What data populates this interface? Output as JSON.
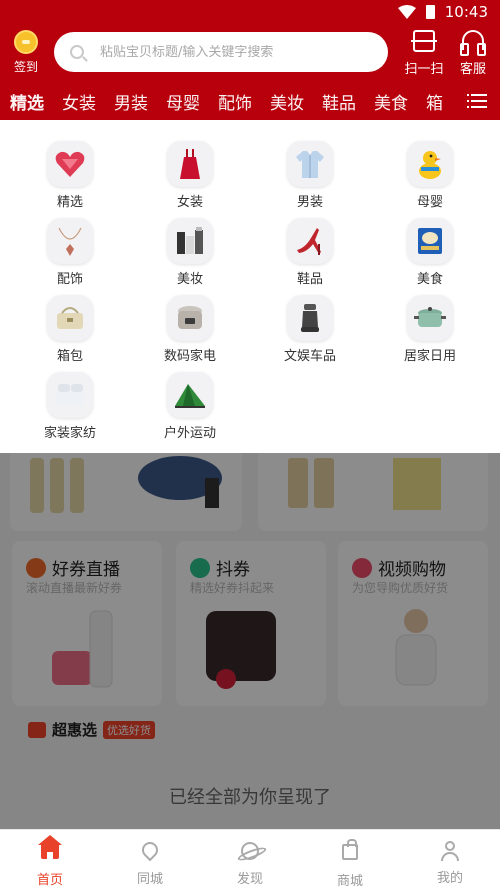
{
  "status_bar": {
    "time": "10:43"
  },
  "header": {
    "signin_label": "签到",
    "search_placeholder": "粘贴宝贝标题/输入关键字搜索",
    "scan_label": "扫一扫",
    "service_label": "客服"
  },
  "tabs": [
    "精选",
    "女装",
    "男装",
    "母婴",
    "配饰",
    "美妆",
    "鞋品",
    "美食",
    "箱"
  ],
  "categories": [
    {
      "label": "精选",
      "icon": "heart-gift-icon"
    },
    {
      "label": "女装",
      "icon": "dress-icon"
    },
    {
      "label": "男装",
      "icon": "shirt-icon"
    },
    {
      "label": "母婴",
      "icon": "duck-toy-icon"
    },
    {
      "label": "配饰",
      "icon": "necklace-icon"
    },
    {
      "label": "美妆",
      "icon": "cosmetics-icon"
    },
    {
      "label": "鞋品",
      "icon": "high-heel-icon"
    },
    {
      "label": "美食",
      "icon": "cookie-tin-icon"
    },
    {
      "label": "箱包",
      "icon": "handbag-icon"
    },
    {
      "label": "数码家电",
      "icon": "rice-cooker-icon"
    },
    {
      "label": "文娱车品",
      "icon": "car-seat-icon"
    },
    {
      "label": "居家日用",
      "icon": "pot-icon"
    },
    {
      "label": "家装家纺",
      "icon": "bedding-icon"
    },
    {
      "label": "户外运动",
      "icon": "tent-icon"
    }
  ],
  "features": [
    {
      "title": "好券直播",
      "subtitle": "滚动直播最新好券",
      "color": "#f06a2a"
    },
    {
      "title": "抖券",
      "subtitle": "精选好券抖起来",
      "color": "#2cc48a"
    },
    {
      "title": "视频购物",
      "subtitle": "为您导购优质好货",
      "color": "#ee4c6a"
    }
  ],
  "super_section": {
    "title": "超惠选",
    "tag": "优选好货"
  },
  "end_text": "已经全部为你呈现了",
  "bottom_nav": [
    {
      "label": "首页",
      "active": true
    },
    {
      "label": "同城",
      "active": false
    },
    {
      "label": "发现",
      "active": false
    },
    {
      "label": "商城",
      "active": false
    },
    {
      "label": "我的",
      "active": false
    }
  ],
  "colors": {
    "primary": "#b8000c",
    "accent": "#e8432a"
  }
}
